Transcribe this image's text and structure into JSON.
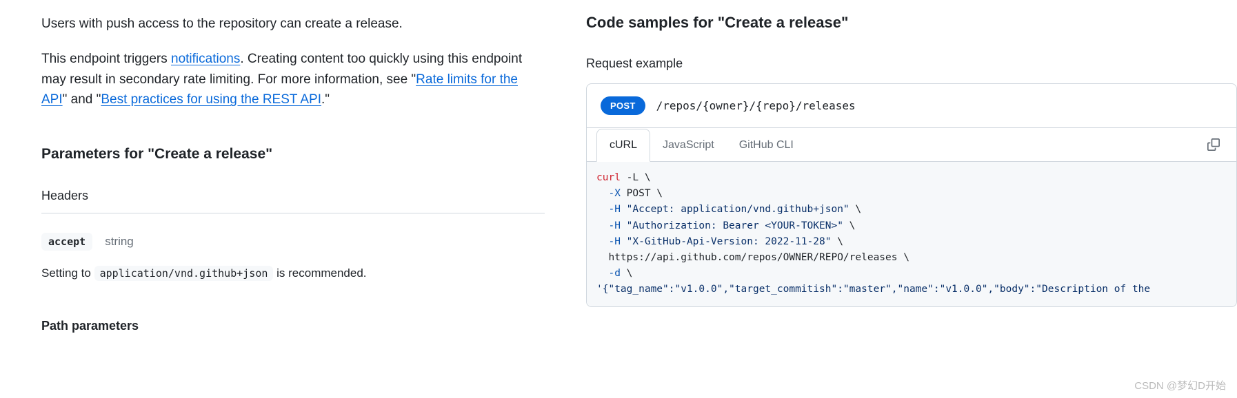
{
  "left": {
    "intro1": "Users with push access to the repository can create a release.",
    "intro2_pre": "This endpoint triggers ",
    "link_notifications": "notifications",
    "intro2_mid": ". Creating content too quickly using this endpoint may result in secondary rate limiting. For more information, see \"",
    "link_rate": "Rate limits for the API",
    "intro2_mid2": "\" and \"",
    "link_best": "Best practices for using the REST API",
    "intro2_end": ".\"",
    "params_heading": "Parameters for \"Create a release\"",
    "headers_heading": "Headers",
    "accept_name": "accept",
    "accept_type": "string",
    "accept_desc_pre": "Setting to ",
    "accept_desc_code": "application/vnd.github+json",
    "accept_desc_post": " is recommended.",
    "path_heading": "Path parameters"
  },
  "right": {
    "heading": "Code samples for \"Create a release\"",
    "req_heading": "Request example",
    "method": "POST",
    "endpoint": "/repos/{owner}/{repo}/releases",
    "tabs": {
      "curl": "cURL",
      "js": "JavaScript",
      "cli": "GitHub CLI"
    },
    "code": {
      "l1a": "curl",
      "l1b": " -L \\",
      "l2a": "  -X",
      "l2b": " POST \\",
      "l3a": "  -H",
      "l3b": " \"Accept: application/vnd.github+json\"",
      "l3c": " \\",
      "l4a": "  -H",
      "l4b": " \"Authorization: Bearer <YOUR-TOKEN>\"",
      "l4c": " \\",
      "l5a": "  -H",
      "l5b": " \"X-GitHub-Api-Version: 2022-11-28\"",
      "l5c": " \\",
      "l6": "  https://api.github.com/repos/OWNER/REPO/releases \\",
      "l7": "  -d",
      "l8": " \\",
      "l9": "'{\"tag_name\":\"v1.0.0\",\"target_commitish\":\"master\",\"name\":\"v1.0.0\",\"body\":\"Description of the"
    }
  },
  "watermark": "CSDN @梦幻D开始"
}
